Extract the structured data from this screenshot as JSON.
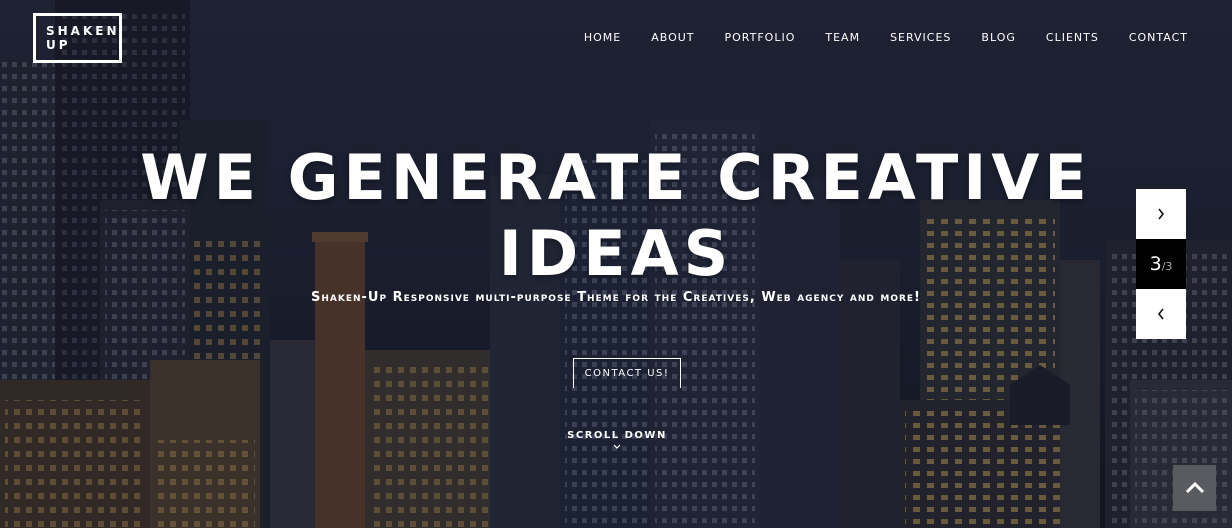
{
  "logo": {
    "line1": "SHAKEN",
    "line2": "UP"
  },
  "nav": {
    "items": [
      {
        "label": "HOME"
      },
      {
        "label": "ABOUT"
      },
      {
        "label": "PORTFOLIO"
      },
      {
        "label": "TEAM"
      },
      {
        "label": "SERVICES"
      },
      {
        "label": "BLOG"
      },
      {
        "label": "CLIENTS"
      },
      {
        "label": "CONTACT"
      }
    ]
  },
  "hero": {
    "headline_line1": "WE GENERATE CREATIVE",
    "headline_line2": "IDEAS",
    "subline": "Shaken-Up Responsive multi-purpose Theme for the Creatives, Web agency and more!",
    "cta_label": "CONTACT US!",
    "scroll_label": "SCROLL DOWN"
  },
  "slider": {
    "current": "3",
    "total": "/3",
    "next_icon": "chevron-right-icon",
    "prev_icon": "chevron-left-icon"
  },
  "back_to_top_icon": "chevron-up-icon",
  "colors": {
    "overlay": "#0a0c18",
    "back_to_top_bg": "#5a5b61",
    "counter_bg": "#000000",
    "arrow_bg": "#ffffff"
  }
}
